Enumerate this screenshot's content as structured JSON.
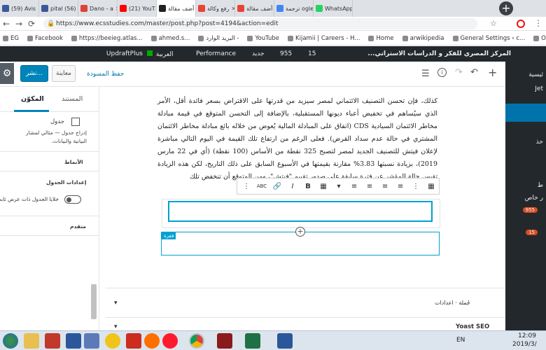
{
  "browser": {
    "tabs": [
      {
        "label": "(59) Avis",
        "color": "#3b5998",
        "active": false
      },
      {
        "label": "pital (56)",
        "color": "#3b5998",
        "active": false
      },
      {
        "label": "Dano - a",
        "color": "#db4437",
        "active": false
      },
      {
        "label": "(21) YouT",
        "color": "#ff0000",
        "active": false
      },
      {
        "label": "أضف مقالة",
        "color": "#222222",
        "active": true
      },
      {
        "label": "رفع وكالة",
        "color": "#ea4335",
        "active": false
      },
      {
        "label": "أضف مقالة",
        "color": "#ea4335",
        "active": false
      },
      {
        "label": "ترجمة ogle",
        "color": "#4285f4",
        "active": false
      },
      {
        "label": "WhatsApp",
        "color": "#25d366",
        "active": false
      }
    ],
    "url": "https://www.ecsstudies.com/master/post.php?post=4194&action=edit",
    "bookmarks": [
      "EG",
      "Facebook",
      "https://beeieg.atlas...",
      "ahmed.s...",
      "البريد الوارد -",
      "YouTube",
      "Kijamii | Careers - H...",
      "Home",
      "arwikipedia",
      "General Settings ‹ c...",
      "Othe"
    ]
  },
  "adminbar": {
    "site_title": "المركز المصري للفكر و الدراسات الاستراتي...",
    "updates": "15",
    "comments": "955",
    "new": "جديد",
    "performance": "Performance",
    "language": "العربية",
    "updraft": "UpdraftPlus"
  },
  "editor": {
    "save_draft": "حفظ المسودة",
    "preview": "معاينة",
    "publish": "نشر...",
    "para_text": "كذلك، فإن تحسن التصنيف الائتماني لمصر سيزيد من قدرتها على الاقتراض بسعر فائدة أقل، الأمر الذي سيُساهم في تخفيض أعباء ديونها المستقبلية، بالإضافة إلى التحسن المتوقع في قيمة مبادلة مخاطر الائتمان السيادية CDS (اتفاق على المبادلة المالية يُعوض من خلاله بائع مبادلة مخاطر الائتمان المشتري في حالة عدم سداد القرض). فعلى الرغم من ارتفاع تلك القيمة في اليوم التالي مباشرة لإعلان فيتش للتصنيف الجديد لمصر لتصبح 325 نقطة من الأساس (100 نقطة) (أي في 22 مارس 2019)، بزيادة نسبتها 3.83% مقارنة بقيمتها في الأسبوع السابق على ذلك التاريخ، لكن هذه الزيادة تقيس حالة المؤشر عن فترة سابقة على صدور تقييم \"فيتش\"، ومن المتوقع أن تنخفض تلك",
    "para_tag": "فقرة"
  },
  "sidebar": {
    "tab_document": "المستند",
    "tab_block": "المكوّن",
    "block_name": "جدول",
    "block_desc_line1": "إدراج جدول — مثالي لمشار",
    "block_desc_line2": "البيانية والبيانات.",
    "styles": "الأنماط",
    "table_settings": "إعدادات الجدول",
    "fixed_toggle": "خلايا الجدول ذات عرض ثابت",
    "advanced": "متقدم"
  },
  "bottom_panels": {
    "settings": "جُملة · اعدادات",
    "yoast": "Yoast SEO"
  },
  "admin_menu": {
    "items": [
      "ئيسية",
      "Jet",
      "",
      "",
      "حذ",
      "",
      "ط",
      "ر خاص",
      "955",
      "15",
      ""
    ],
    "badge_comments": "955",
    "badge_updates": "15"
  },
  "taskbar": {
    "lang": "EN",
    "time": "12:09",
    "date": "2019/3/"
  }
}
